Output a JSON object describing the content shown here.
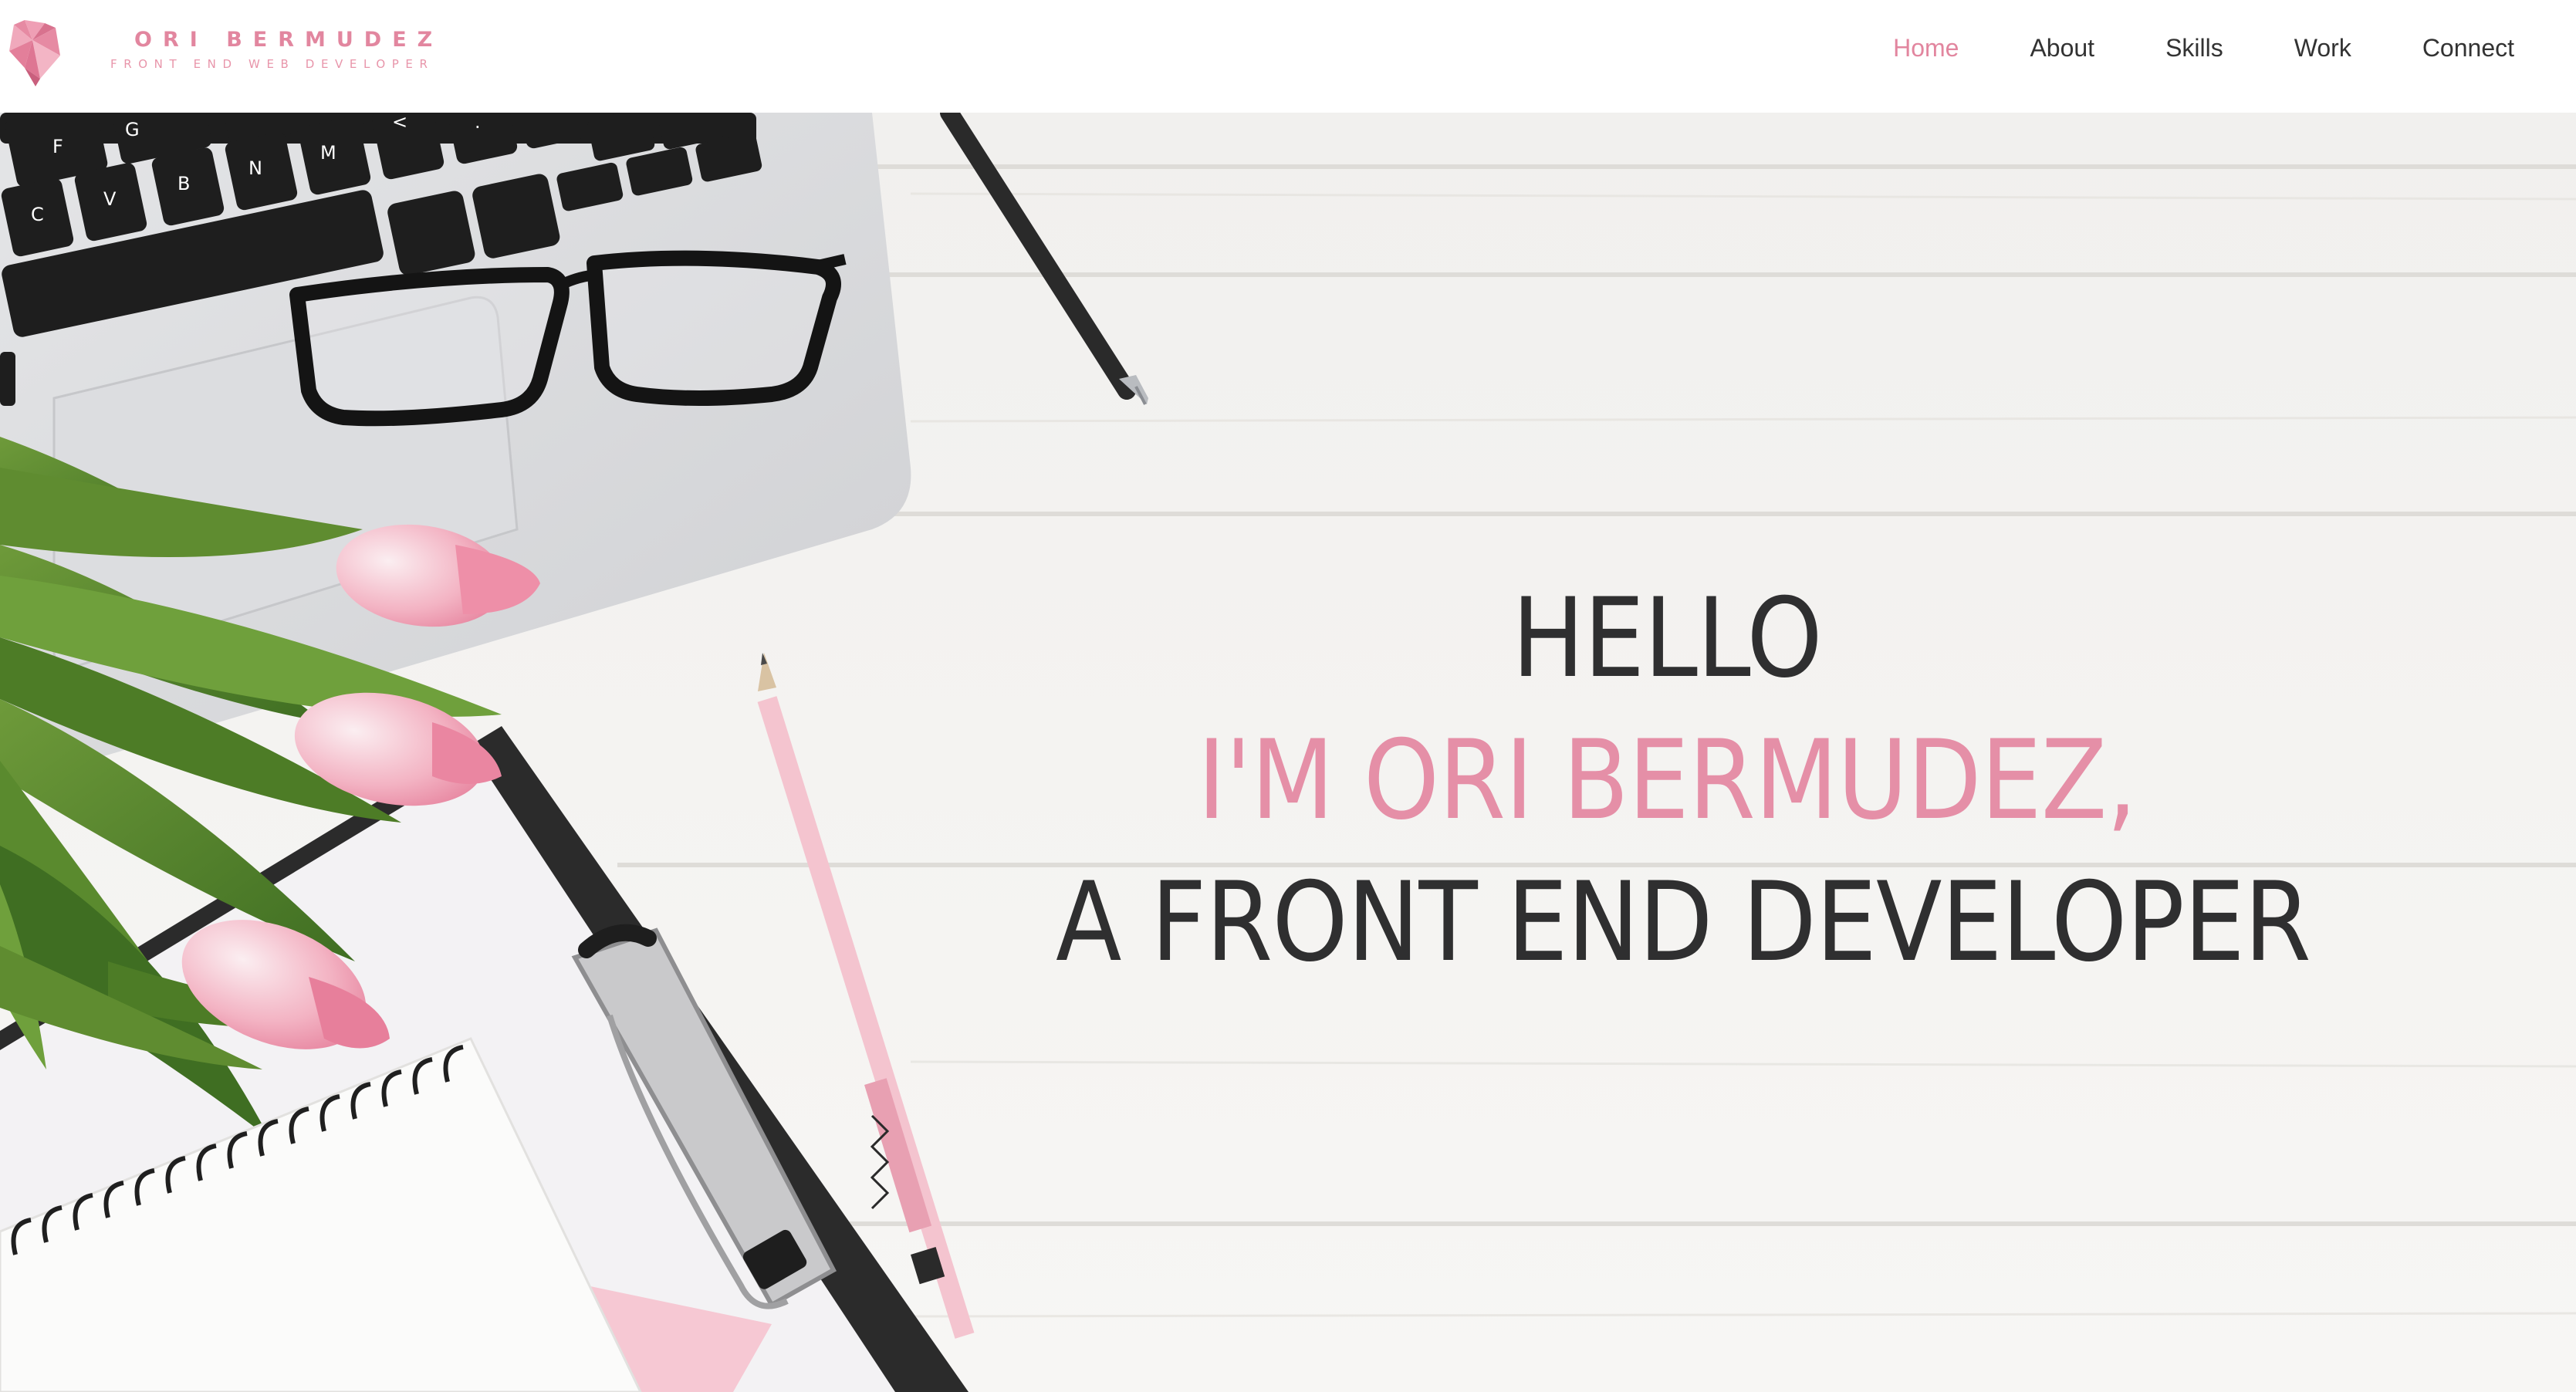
{
  "brand": {
    "name": "ORI BERMUDEZ",
    "tagline": "FRONT END WEB DEVELOPER",
    "logo_icon": "pink-heart-fox-icon",
    "accent_color": "#e2869f"
  },
  "nav": {
    "items": [
      {
        "label": "Home",
        "active": true
      },
      {
        "label": "About",
        "active": false
      },
      {
        "label": "Skills",
        "active": false
      },
      {
        "label": "Work",
        "active": false
      },
      {
        "label": "Connect",
        "active": false
      }
    ]
  },
  "hero": {
    "line1": "HELLO",
    "line2": "I'M ORI BERMUDEZ,",
    "line3": "A FRONT END DEVELOPER",
    "text_color": "#2f2f30",
    "highlight_color": "#e58fa7",
    "background_photo": "desk-flatlay-laptop-glasses-tulips-clipboard-notebook-pencil-pen",
    "keyboard_keys": [
      "F",
      "G",
      "<",
      ".",
      "C",
      "V",
      "B",
      "N",
      "M"
    ]
  }
}
